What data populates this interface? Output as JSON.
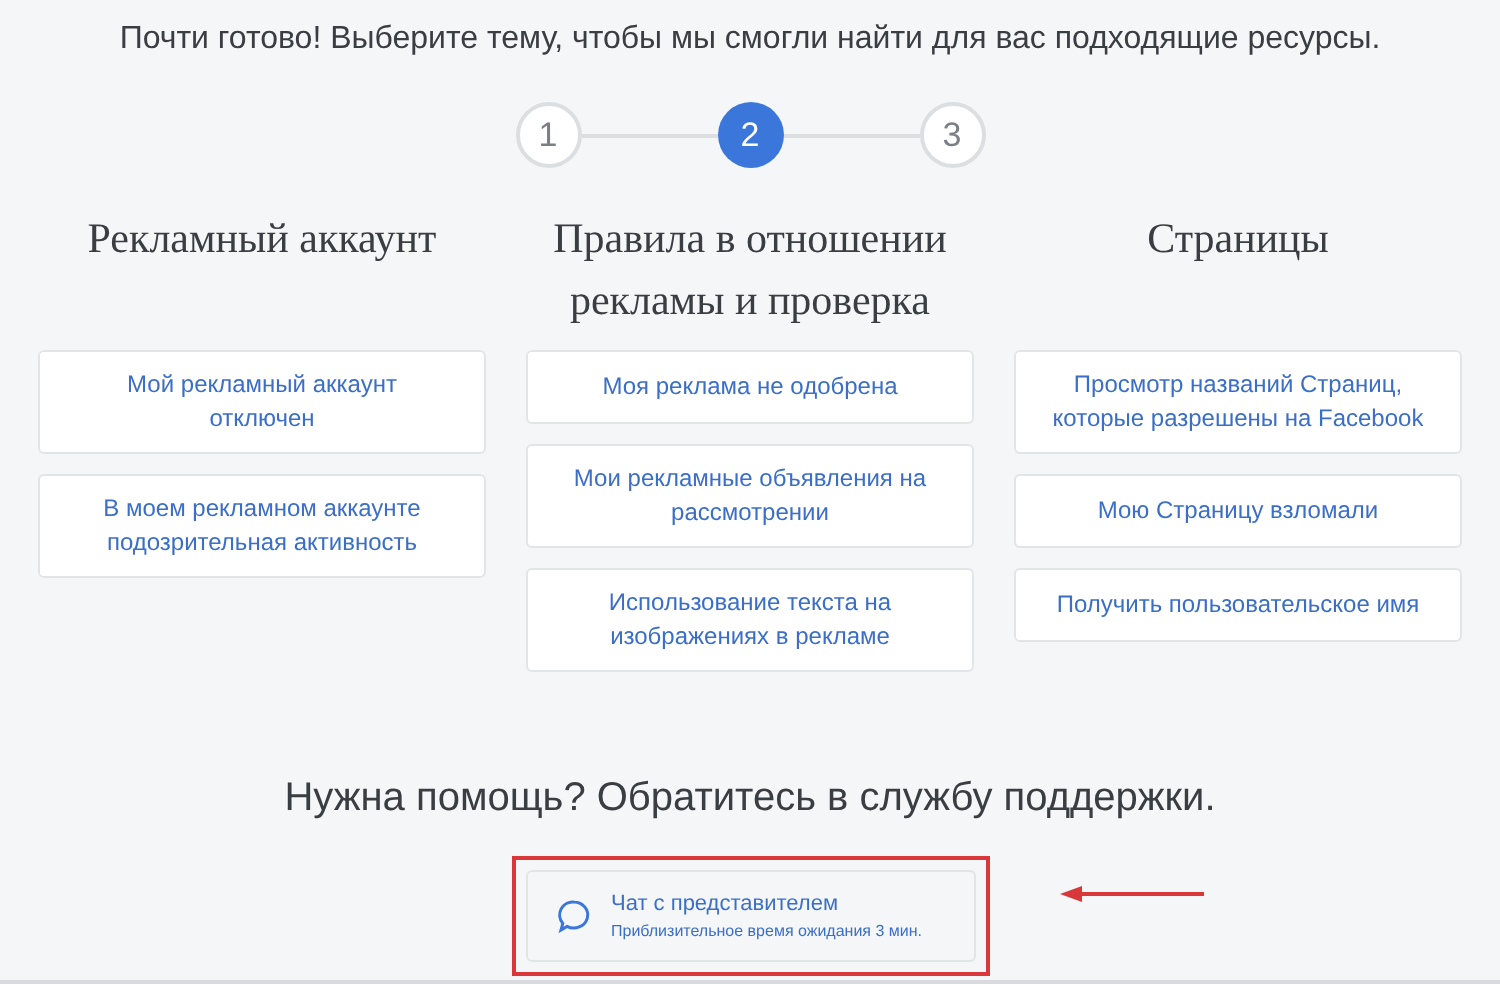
{
  "headline": "Почти готово! Выберите тему, чтобы мы смогли найти для вас подходящие ресурсы.",
  "steps": [
    {
      "label": "1",
      "selected": false
    },
    {
      "label": "2",
      "selected": true
    },
    {
      "label": "3",
      "selected": false
    }
  ],
  "columns": [
    {
      "title": "Рекламный аккаунт",
      "items": [
        "Мой рекламный аккаунт отключен",
        "В моем рекламном аккаунте подозрительная активность"
      ]
    },
    {
      "title": "Правила в отношении рекламы и проверка",
      "items": [
        "Моя реклама не одобрена",
        "Мои рекламные объявления на рассмотрении",
        "Использование текста на изображениях в рекламе"
      ]
    },
    {
      "title": "Страницы",
      "items": [
        "Просмотр названий Страниц, которые разрешены на Facebook",
        "Мою Страницу взломали",
        "Получить пользовательское имя"
      ]
    }
  ],
  "help": {
    "title": "Нужна помощь? Обратитесь в службу поддержки.",
    "chat": {
      "label": "Чат с представителем",
      "wait": "Приблизительное время ожидания 3 мин."
    }
  }
}
